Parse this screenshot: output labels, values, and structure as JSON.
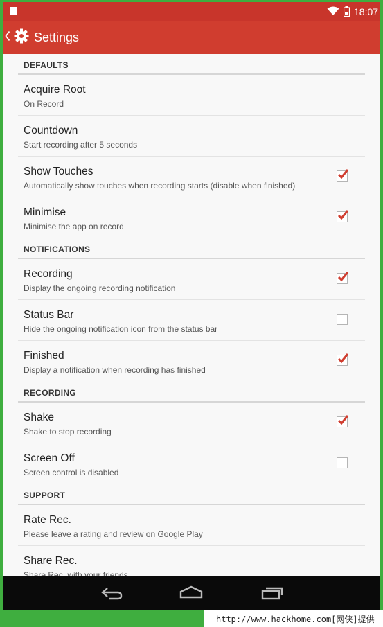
{
  "status_bar": {
    "time": "18:07"
  },
  "app_bar": {
    "title": "Settings"
  },
  "sections": [
    {
      "header": "DEFAULTS",
      "items": [
        {
          "title": "Acquire Root",
          "subtitle": "On Record",
          "checkbox": null
        },
        {
          "title": "Countdown",
          "subtitle": "Start recording after 5 seconds",
          "checkbox": null
        },
        {
          "title": "Show Touches",
          "subtitle": "Automatically show touches when recording starts (disable when finished)",
          "checkbox": true
        },
        {
          "title": "Minimise",
          "subtitle": "Minimise the app on record",
          "checkbox": true
        }
      ]
    },
    {
      "header": "NOTIFICATIONS",
      "items": [
        {
          "title": "Recording",
          "subtitle": "Display the ongoing recording notification",
          "checkbox": true
        },
        {
          "title": "Status Bar",
          "subtitle": "Hide the ongoing notification icon from the status bar",
          "checkbox": false
        },
        {
          "title": "Finished",
          "subtitle": "Display a notification when recording has finished",
          "checkbox": true
        }
      ]
    },
    {
      "header": "RECORDING",
      "items": [
        {
          "title": "Shake",
          "subtitle": "Shake to stop recording",
          "checkbox": true
        },
        {
          "title": "Screen Off",
          "subtitle": "Screen control is disabled",
          "checkbox": false
        }
      ]
    },
    {
      "header": "SUPPORT",
      "items": [
        {
          "title": "Rate Rec.",
          "subtitle": "Please leave a rating and review on Google Play",
          "checkbox": null
        },
        {
          "title": "Share Rec.",
          "subtitle": "Share Rec. with your friends",
          "checkbox": null
        }
      ]
    }
  ],
  "watermark": {
    "text": "http://www.hackhome.com[网侠]提供"
  },
  "colors": {
    "accent": "#d03d2f",
    "status_bar": "#c8352b",
    "frame": "#3fae3f",
    "checkmark": "#d03d2f"
  }
}
